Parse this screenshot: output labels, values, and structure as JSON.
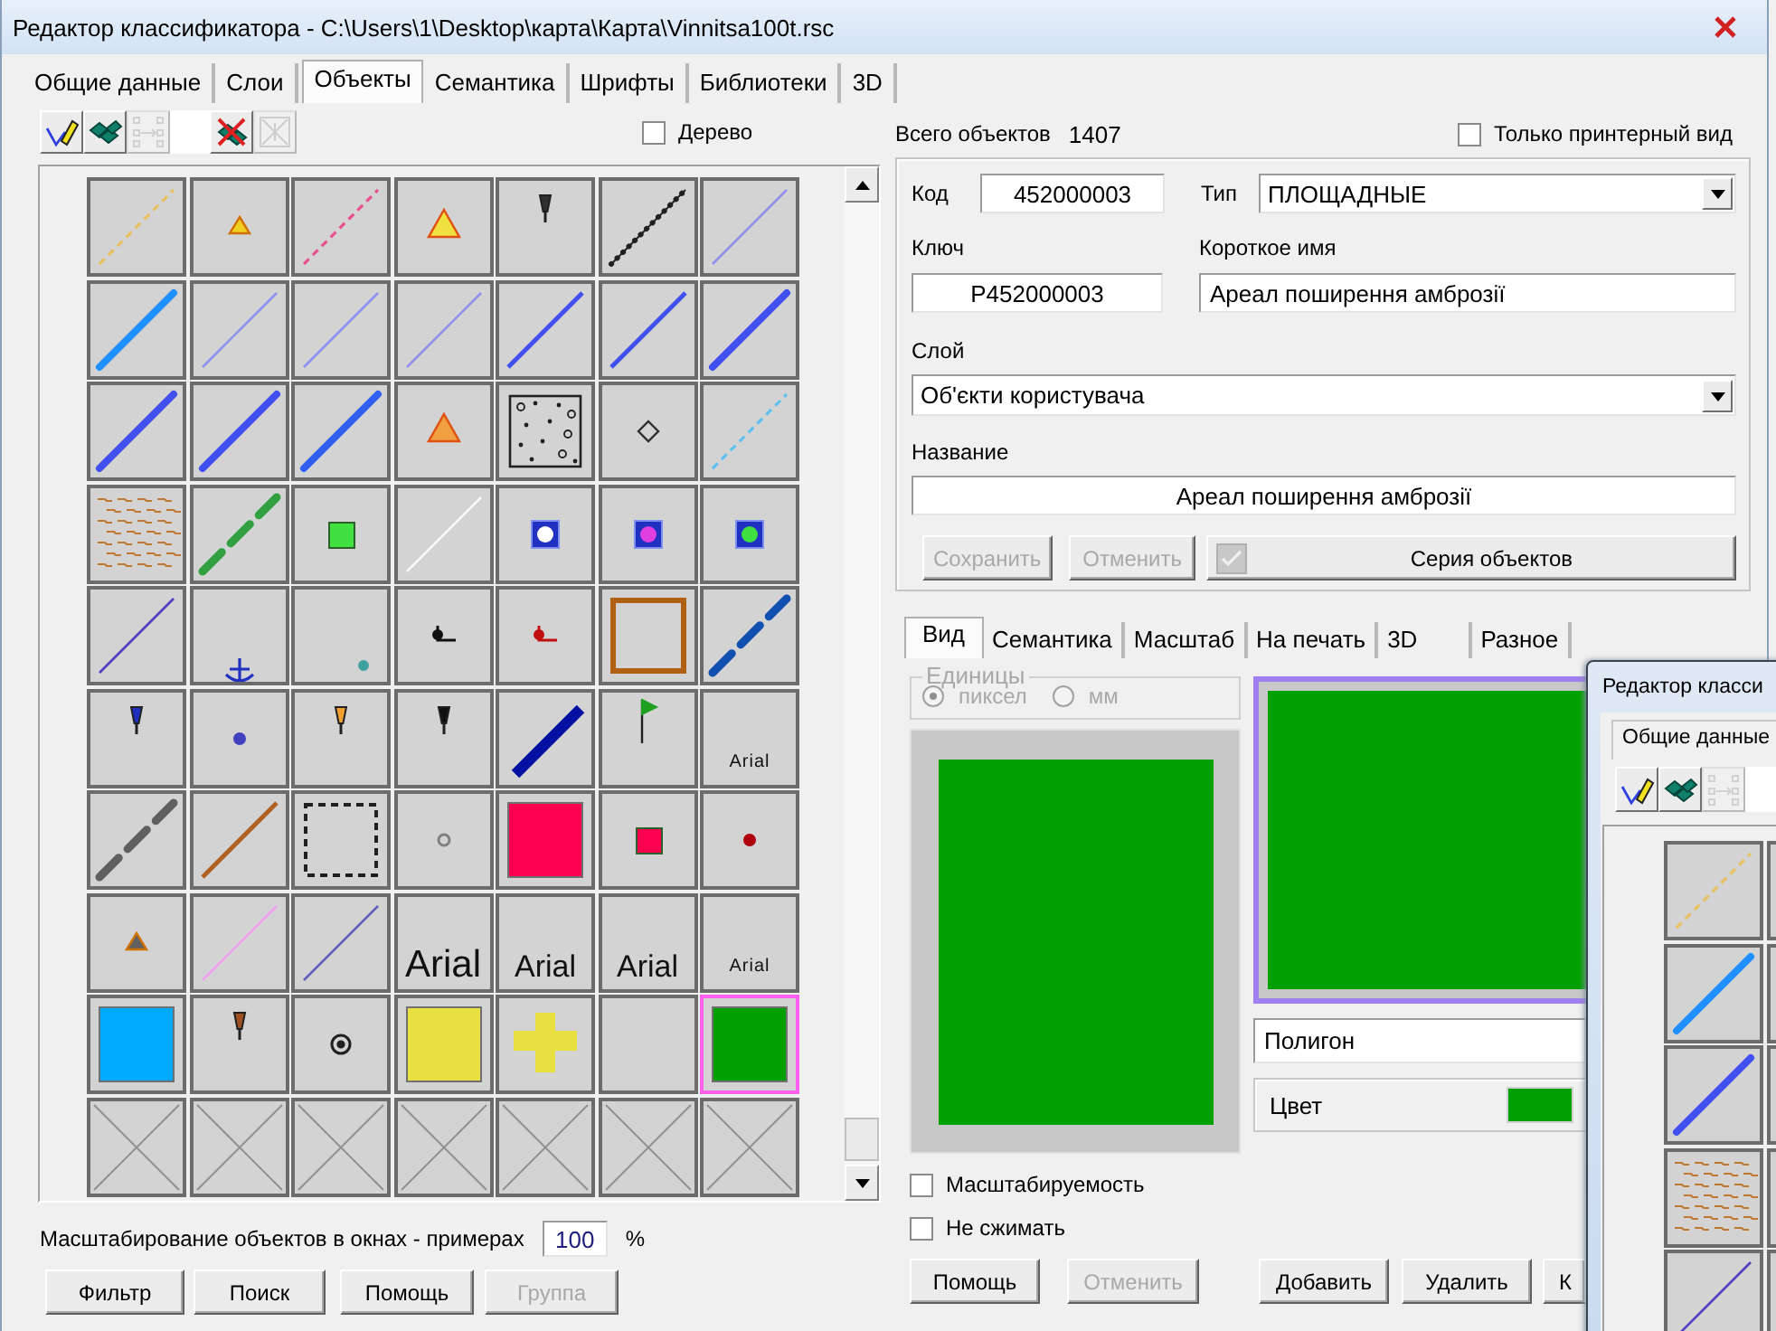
{
  "main_window": {
    "title": "Редактор классификатора - C:\\Users\\1\\Desktop\\карта\\Карта\\Vinnitsa100t.rsc"
  },
  "tabs": [
    {
      "label": "Общие данные",
      "selected": false
    },
    {
      "label": "Слои",
      "selected": false
    },
    {
      "label": "Объекты",
      "selected": true
    },
    {
      "label": "Семантика",
      "selected": false
    },
    {
      "label": "Шрифты",
      "selected": false
    },
    {
      "label": "Библиотеки",
      "selected": false
    },
    {
      "label": "3D",
      "selected": false
    }
  ],
  "objects_panel": {
    "toolbar": [
      {
        "kind": "edit",
        "disabled": false
      },
      {
        "kind": "layers",
        "disabled": false
      },
      {
        "kind": "move",
        "disabled": true
      },
      {
        "kind": "delete",
        "disabled": false
      },
      {
        "kind": "clear",
        "disabled": true
      }
    ],
    "tree_checkbox": {
      "label": "Дерево",
      "checked": false
    },
    "cells": [
      {
        "kind": "dashed-line",
        "color": "#e8c060",
        "selected": false
      },
      {
        "kind": "triangle",
        "color": "#f0d020",
        "selected": false
      },
      {
        "kind": "dashed-line",
        "color": "#e85090",
        "selected": false
      },
      {
        "kind": "triangle-large",
        "color": "#f0e040",
        "selected": false
      },
      {
        "kind": "pin",
        "color": "#303030",
        "selected": false
      },
      {
        "kind": "dotted-line",
        "color": "#202020",
        "selected": false
      },
      {
        "kind": "thin-line",
        "color": "#9090f0",
        "selected": false
      },
      {
        "kind": "thick-line",
        "color": "#2090ff",
        "selected": false
      },
      {
        "kind": "thin-line",
        "color": "#9090f0",
        "selected": false
      },
      {
        "kind": "thin-line",
        "color": "#9090f0",
        "selected": false
      },
      {
        "kind": "thin-line",
        "color": "#9090f0",
        "selected": false
      },
      {
        "kind": "line",
        "color": "#4050f0",
        "selected": false
      },
      {
        "kind": "line",
        "color": "#4050f0",
        "selected": false
      },
      {
        "kind": "thick-line",
        "color": "#4050f0",
        "selected": false
      },
      {
        "kind": "thick-line",
        "color": "#4050f0",
        "selected": false
      },
      {
        "kind": "thick-line",
        "color": "#4050f0",
        "selected": false
      },
      {
        "kind": "thick-line",
        "color": "#3060f0",
        "selected": false
      },
      {
        "kind": "triangle-large",
        "color": "#f0a040",
        "selected": false
      },
      {
        "kind": "dotted-area",
        "color": "#202020",
        "selected": false
      },
      {
        "kind": "diamond",
        "color": "#303030",
        "selected": false
      },
      {
        "kind": "dashed-line",
        "color": "#60c0f0",
        "selected": false
      },
      {
        "kind": "brick",
        "color": "#c07830",
        "selected": false
      },
      {
        "kind": "broken-line",
        "color": "#30a040",
        "selected": false
      },
      {
        "kind": "square-small",
        "color": "#40e040",
        "selected": false
      },
      {
        "kind": "thin-line",
        "color": "#f8f8f8",
        "selected": false
      },
      {
        "kind": "marker",
        "color": "#ffffff",
        "selected": false
      },
      {
        "kind": "marker",
        "color": "#e040e0",
        "selected": false
      },
      {
        "kind": "marker",
        "color": "#40e040",
        "selected": false
      },
      {
        "kind": "thin-line",
        "color": "#5040c0",
        "selected": false
      },
      {
        "kind": "anchor",
        "color": "#2030c0",
        "selected": false
      },
      {
        "kind": "dot-low",
        "color": "#40a0a0",
        "selected": false
      },
      {
        "kind": "corner",
        "color": "#101010",
        "selected": false
      },
      {
        "kind": "corner",
        "color": "#c01010",
        "selected": false
      },
      {
        "kind": "frame",
        "color": "#b06010",
        "selected": false
      },
      {
        "kind": "broken-line",
        "color": "#1050b0",
        "selected": false
      },
      {
        "kind": "pin",
        "color": "#2030c0",
        "selected": false
      },
      {
        "kind": "dot",
        "color": "#4040c0",
        "selected": false
      },
      {
        "kind": "pin",
        "color": "#f0a030",
        "selected": false
      },
      {
        "kind": "pin",
        "color": "#101010",
        "selected": false
      },
      {
        "kind": "heavy-line",
        "color": "#0010a0",
        "selected": false
      },
      {
        "kind": "flag",
        "color": "#20a020",
        "selected": false
      },
      {
        "kind": "text-small",
        "label": "Arial",
        "selected": false
      },
      {
        "kind": "broken-line",
        "color": "#606060",
        "selected": false
      },
      {
        "kind": "line",
        "color": "#b06020",
        "selected": false
      },
      {
        "kind": "dashed-frame",
        "color": "#202020",
        "selected": false
      },
      {
        "kind": "ring",
        "color": "#808080",
        "selected": false
      },
      {
        "kind": "square",
        "color": "#ff0050",
        "selected": false
      },
      {
        "kind": "square-small",
        "color": "#ff0050",
        "selected": false
      },
      {
        "kind": "dot",
        "color": "#b00010",
        "selected": false
      },
      {
        "kind": "triangle",
        "color": "#606060",
        "selected": false
      },
      {
        "kind": "thin-line",
        "color": "#f0a0f0",
        "selected": false
      },
      {
        "kind": "thin-line",
        "color": "#6060c0",
        "selected": false
      },
      {
        "kind": "text-large",
        "label": "Arial",
        "selected": false
      },
      {
        "kind": "text",
        "label": "Arial",
        "selected": false
      },
      {
        "kind": "text",
        "label": "Arial",
        "selected": false
      },
      {
        "kind": "text-small",
        "label": "Arial",
        "selected": false
      },
      {
        "kind": "square",
        "color": "#00aaff",
        "selected": false
      },
      {
        "kind": "pin",
        "color": "#a05020",
        "selected": false
      },
      {
        "kind": "target",
        "color": "#202020",
        "selected": false
      },
      {
        "kind": "square",
        "color": "#e8e040",
        "selected": false
      },
      {
        "kind": "plus",
        "color": "#e8e040",
        "selected": false
      },
      {
        "kind": "none",
        "selected": false
      },
      {
        "kind": "square",
        "color": "#00a000",
        "selected": true
      },
      {
        "kind": "blank",
        "selected": false
      },
      {
        "kind": "blank",
        "selected": false
      },
      {
        "kind": "blank",
        "selected": false
      },
      {
        "kind": "blank",
        "selected": false
      },
      {
        "kind": "blank",
        "selected": false
      },
      {
        "kind": "blank",
        "selected": false
      },
      {
        "kind": "blank",
        "selected": false
      }
    ],
    "scale_label": "Масштабирование объектов в окнах - примерах",
    "scale_value": "100",
    "scale_unit": "%",
    "buttons": [
      {
        "label": "Фильтр",
        "disabled": false
      },
      {
        "label": "Поиск",
        "disabled": false
      },
      {
        "label": "Помощь",
        "disabled": false
      },
      {
        "label": "Группа",
        "disabled": true
      }
    ]
  },
  "object_details": {
    "total_label": "Всего объектов",
    "total_value": "1407",
    "printer_checkbox": {
      "label": "Только принтерный вид",
      "checked": false
    },
    "code": {
      "label": "Код",
      "value": "452000003"
    },
    "type": {
      "label": "Тип",
      "value": "ПЛОЩАДНЫЕ"
    },
    "key": {
      "label": "Ключ",
      "value": "P452000003"
    },
    "short_name": {
      "label": "Короткое имя",
      "value": "Ареал поширення амброзії"
    },
    "layer": {
      "label": "Слой",
      "value": "Об'єкти користувача"
    },
    "name": {
      "label": "Название",
      "value": "Ареал поширення амброзії"
    },
    "buttons": [
      {
        "kind": "plain",
        "label": "Сохранить",
        "disabled": true
      },
      {
        "kind": "plain",
        "label": "Отменить",
        "disabled": true
      },
      {
        "kind": "series",
        "label": "Серия объектов",
        "disabled": false
      }
    ]
  },
  "view_tab": {
    "tabs": [
      {
        "label": "Вид",
        "selected": true
      },
      {
        "label": "Семантика",
        "selected": false
      },
      {
        "label": "Масштаб",
        "selected": false
      },
      {
        "label": "На печать",
        "selected": false
      },
      {
        "label": "3D",
        "selected": false
      },
      {
        "label": "Разное",
        "selected": false
      }
    ],
    "units": {
      "label": "Единицы",
      "disabled": true,
      "options": [
        {
          "label": "пиксел",
          "selected": true
        },
        {
          "label": "мм",
          "selected": false
        }
      ]
    },
    "shape_field": {
      "value": "Полигон"
    },
    "color_field": {
      "label": "Цвет",
      "color": "#00a000"
    },
    "checkboxes": [
      {
        "label": "Масштабируемость",
        "checked": false
      },
      {
        "label": "Не сжимать",
        "checked": false
      }
    ],
    "buttons": [
      {
        "label": "Помощь",
        "disabled": false
      },
      {
        "label": "Отменить",
        "disabled": true
      },
      {
        "label": "Добавить",
        "disabled": false
      },
      {
        "label": "Удалить",
        "disabled": false
      },
      {
        "label": "К",
        "disabled": false
      }
    ]
  },
  "overlay_window": {
    "title": "Редактор класси",
    "tabs": [
      {
        "label": "Общие данные",
        "selected": false
      }
    ],
    "toolbar": [
      {
        "kind": "edit",
        "disabled": false
      },
      {
        "kind": "layers",
        "disabled": false
      },
      {
        "kind": "move",
        "disabled": true
      }
    ],
    "cells": [
      {
        "kind": "dashed-line",
        "color": "#e8c060",
        "selected": false
      },
      {
        "kind": "thick-line",
        "color": "#2090ff",
        "selected": false
      },
      {
        "kind": "thick-line",
        "color": "#4050f0",
        "selected": false
      },
      {
        "kind": "brick",
        "color": "#c07830",
        "selected": false
      },
      {
        "kind": "thin-line",
        "color": "#5040c0",
        "selected": false
      }
    ]
  }
}
